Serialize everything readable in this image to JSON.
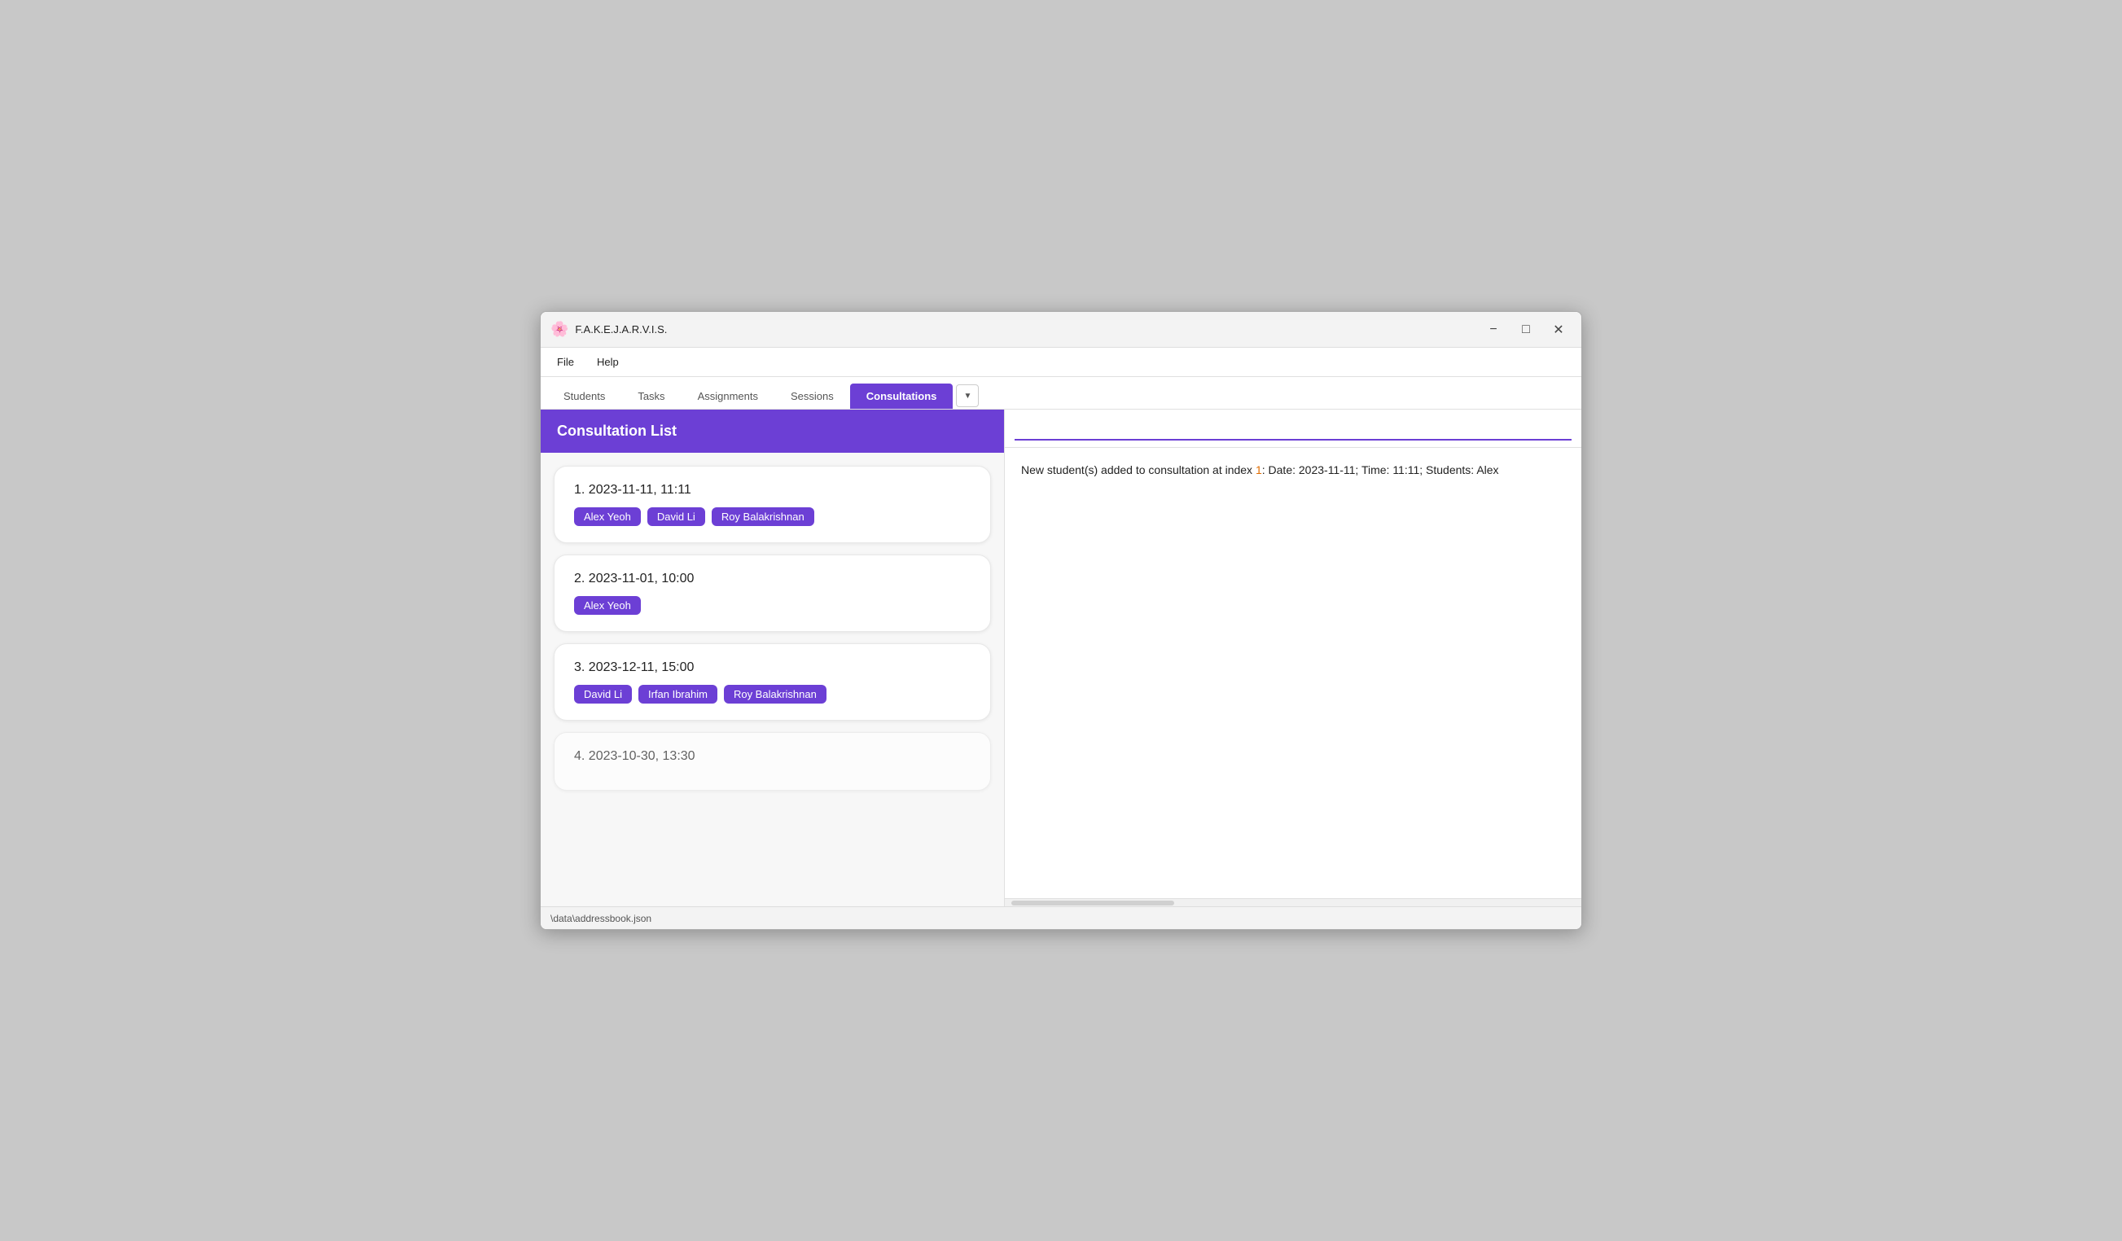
{
  "app": {
    "logo": "🌸",
    "title": "F.A.K.E.J.A.R.V.I.S.",
    "controls": {
      "minimize": "−",
      "maximize": "□",
      "close": "✕"
    }
  },
  "menubar": {
    "items": [
      "File",
      "Help"
    ]
  },
  "tabs": {
    "items": [
      {
        "label": "Students",
        "active": false
      },
      {
        "label": "Tasks",
        "active": false
      },
      {
        "label": "Assignments",
        "active": false
      },
      {
        "label": "Sessions",
        "active": false
      },
      {
        "label": "Consultations",
        "active": true
      }
    ],
    "dropdown_symbol": "▼"
  },
  "left_panel": {
    "header": "Consultation List",
    "consultations": [
      {
        "index": 1,
        "date": "2023-11-11",
        "time": "11:11",
        "display": "1.  2023-11-11,  11:11",
        "students": [
          "Alex Yeoh",
          "David Li",
          "Roy Balakrishnan"
        ]
      },
      {
        "index": 2,
        "date": "2023-11-01",
        "time": "10:00",
        "display": "2.  2023-11-01,  10:00",
        "students": [
          "Alex Yeoh"
        ]
      },
      {
        "index": 3,
        "date": "2023-12-11",
        "time": "15:00",
        "display": "3.  2023-12-11,  15:00",
        "students": [
          "David Li",
          "Irfan Ibrahim",
          "Roy Balakrishnan"
        ]
      },
      {
        "index": 4,
        "date": "2023-10-30",
        "time": "13:30",
        "display": "4.  2023-10-30,  13:30",
        "students": []
      }
    ]
  },
  "right_panel": {
    "input_placeholder": "",
    "output": {
      "prefix": "New student(s) added to consultation at index ",
      "index": "1",
      "middle": ": Date: 2023-11-11; Time: 11:11; Students: Alex"
    }
  },
  "statusbar": {
    "text": "\\data\\addressbook.json"
  }
}
